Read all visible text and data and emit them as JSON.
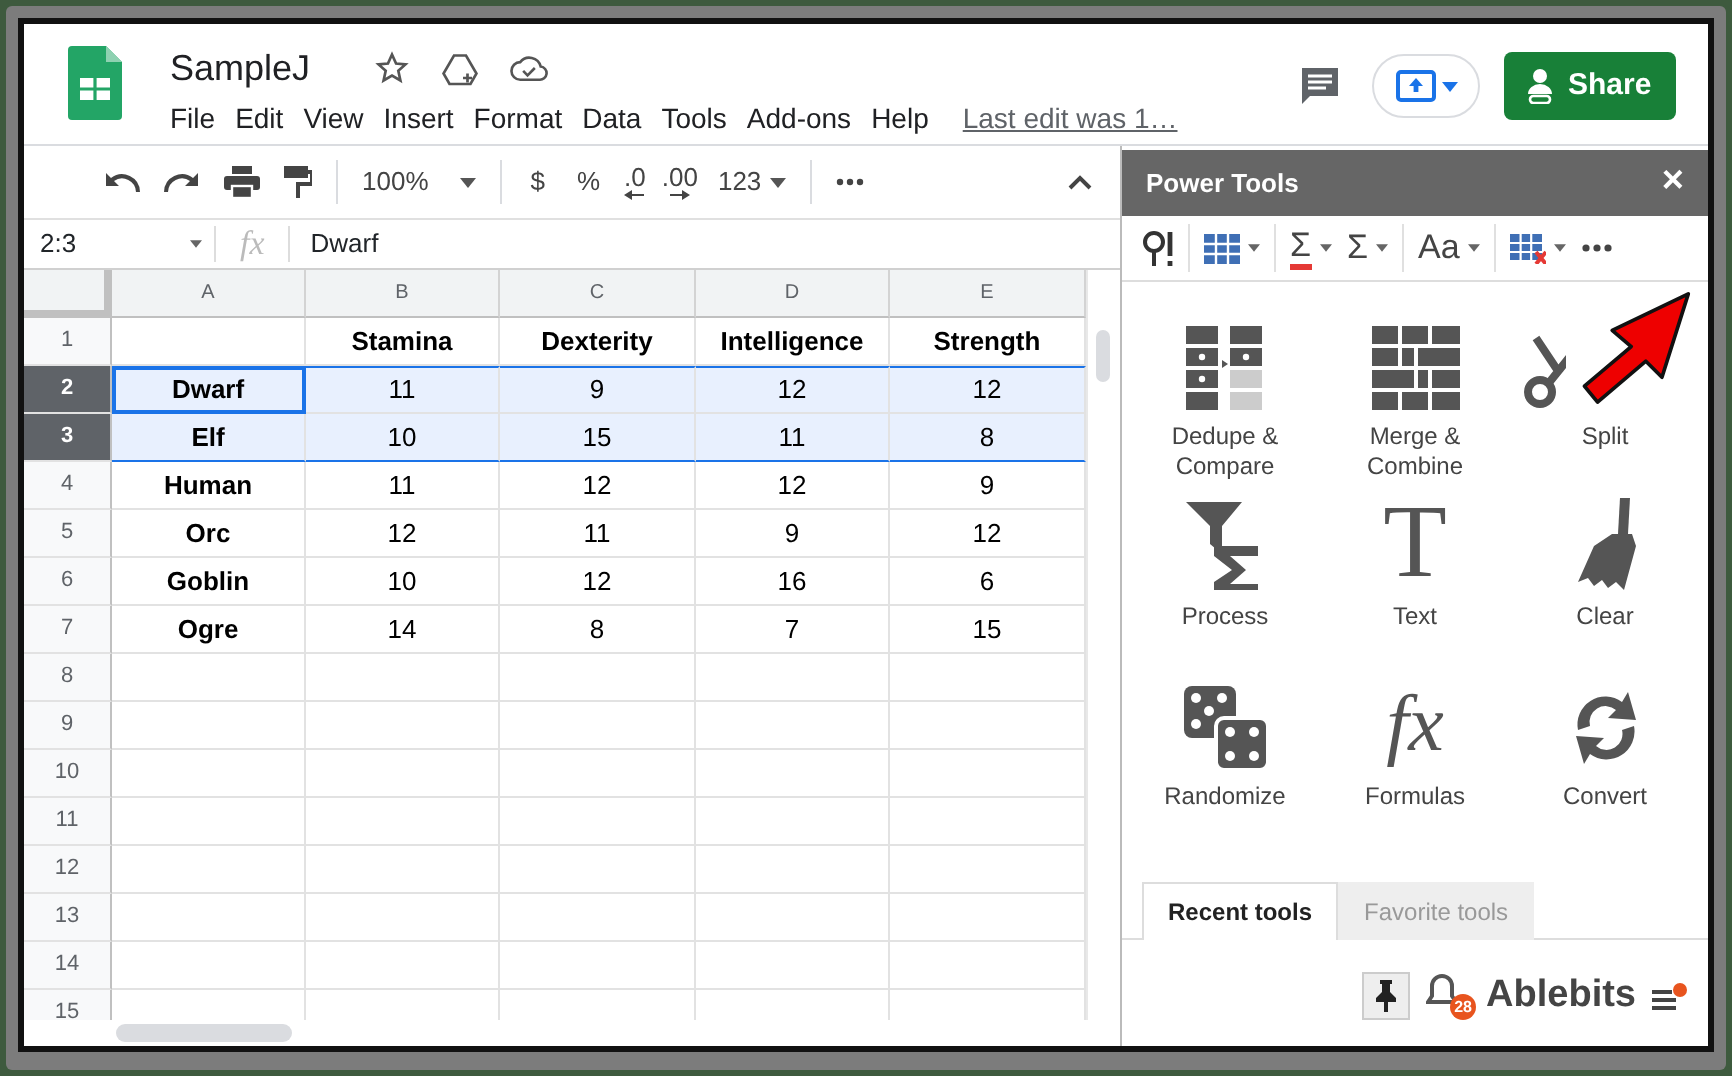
{
  "document": {
    "title": "SampleJ",
    "menus": [
      "File",
      "Edit",
      "View",
      "Insert",
      "Format",
      "Data",
      "Tools",
      "Add-ons",
      "Help"
    ],
    "last_edit": "Last edit was 1…",
    "share": "Share"
  },
  "toolbar": {
    "zoom": "100%",
    "currency": "$",
    "percent": "%",
    "decrease_decimals": ".0",
    "increase_decimals": ".00",
    "number_format": "123"
  },
  "formula_bar": {
    "cell_reference": "2:3",
    "fx": "fx",
    "value": "Dwarf"
  },
  "sheet": {
    "columns": [
      "A",
      "B",
      "C",
      "D",
      "E"
    ],
    "rows": [
      {
        "number": "1",
        "selected": false,
        "active": false,
        "cells": [
          null,
          "Stamina",
          "Dexterity",
          "Intelligence",
          "Strength"
        ]
      },
      {
        "number": "2",
        "selected": true,
        "active": true,
        "cells": [
          "Dwarf",
          "11",
          "9",
          "12",
          "12"
        ]
      },
      {
        "number": "3",
        "selected": true,
        "active": false,
        "cells": [
          "Elf",
          "10",
          "15",
          "11",
          "8"
        ]
      },
      {
        "number": "4",
        "selected": false,
        "active": false,
        "cells": [
          "Human",
          "11",
          "12",
          "12",
          "9"
        ]
      },
      {
        "number": "5",
        "selected": false,
        "active": false,
        "cells": [
          "Orc",
          "12",
          "11",
          "9",
          "12"
        ]
      },
      {
        "number": "6",
        "selected": false,
        "active": false,
        "cells": [
          "Goblin",
          "10",
          "12",
          "16",
          "6"
        ]
      },
      {
        "number": "7",
        "selected": false,
        "active": false,
        "cells": [
          "Ogre",
          "14",
          "8",
          "7",
          "15"
        ]
      },
      {
        "number": "8",
        "selected": false,
        "active": false
      },
      {
        "number": "9",
        "selected": false,
        "active": false
      },
      {
        "number": "10",
        "selected": false,
        "active": false
      },
      {
        "number": "11",
        "selected": false,
        "active": false
      },
      {
        "number": "12",
        "selected": false,
        "active": false
      },
      {
        "number": "13",
        "selected": false,
        "active": false
      },
      {
        "number": "14",
        "selected": false,
        "active": false
      },
      {
        "number": "15",
        "selected": false,
        "active": false
      }
    ]
  },
  "panel": {
    "title": "Power Tools",
    "close": "×",
    "toolbar": [
      {
        "glyph": "Σ",
        "underlined": true
      },
      {
        "glyph": "Σ",
        "underlined": false
      },
      {
        "glyph": "Aa",
        "underlined": false
      }
    ],
    "tools": [
      {
        "kind": "dedupe",
        "label": "Dedupe & Compare"
      },
      {
        "kind": "merge",
        "label": "Merge & Combine"
      },
      {
        "kind": "split",
        "label": "Split"
      },
      {
        "kind": "process",
        "label": "Process"
      },
      {
        "kind": "text",
        "glyph": "T",
        "label": "Text"
      },
      {
        "kind": "clear",
        "label": "Clear"
      },
      {
        "kind": "randomize",
        "label": "Randomize"
      },
      {
        "kind": "formulas",
        "glyph": "fx",
        "label": "Formulas"
      },
      {
        "kind": "convert",
        "label": "Convert"
      }
    ],
    "tabs": [
      {
        "label": "Recent tools",
        "selected": true
      },
      {
        "label": "Favorite tools",
        "selected": false
      }
    ],
    "pinned": true,
    "badge": "28",
    "brand": "Ablebits"
  }
}
